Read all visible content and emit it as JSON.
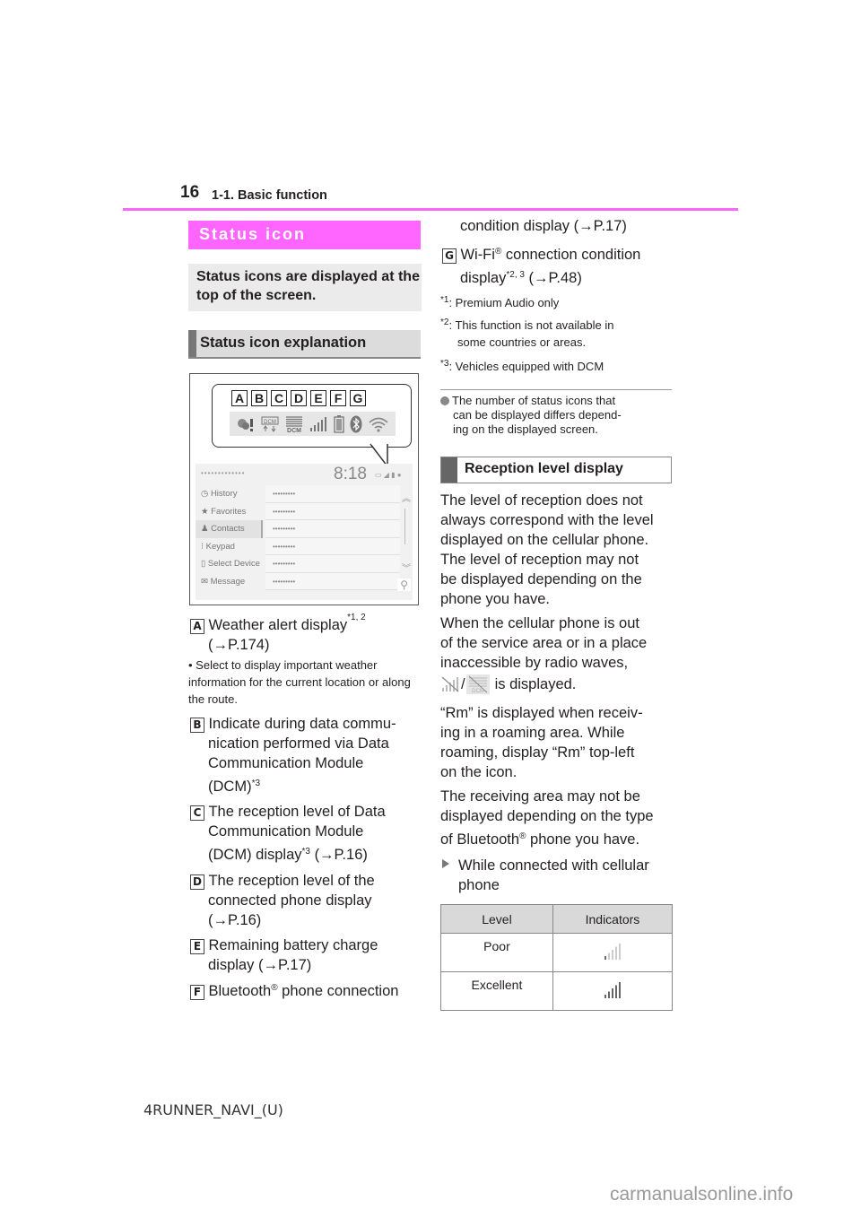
{
  "header": {
    "page_number": "16",
    "section": "1-1. Basic function"
  },
  "left": {
    "section_heading": "Status icon",
    "intro": "Status icons are displayed at the top of the screen.",
    "sub_heading": "Status icon explanation",
    "figure": {
      "letters": [
        "A",
        "B",
        "C",
        "D",
        "E",
        "F",
        "G"
      ],
      "icons": [
        "weather-alert-icon",
        "dcm-data-transfer-icon",
        "dcm-reception-icon",
        "phone-reception-icon",
        "battery-icon",
        "bluetooth-icon",
        "wifi-icon"
      ],
      "dcm_label": "DCM",
      "clock": "8:18",
      "masked_title": "•••••••••••••",
      "menu": [
        "History",
        "Favorites",
        "Contacts",
        "Keypad",
        "Select Device",
        "Message"
      ],
      "active_menu": "Contacts",
      "rows": [
        "•••••••••",
        "•••••••••",
        "•••••••••",
        "•••••••••",
        "•••••••••",
        "•••••••••"
      ]
    },
    "items": [
      {
        "letter": "A",
        "text": "Weather alert display",
        "sup": "*1, 2",
        "ref": "(→P.174)",
        "note": "• Select to display important weather information for the current location or along the route."
      },
      {
        "letter": "B",
        "line1": "Indicate during data commu-",
        "line2": "nication performed via Data",
        "line3": "Communication Module",
        "line4": "(DCM)",
        "sup": "*3"
      },
      {
        "letter": "C",
        "line1": "The reception level of Data",
        "line2": "Communication Module",
        "line3": "(DCM) display",
        "sup": "*3",
        "ref": "(→P.16)"
      },
      {
        "letter": "D",
        "line1": "The reception level of the",
        "line2": "connected phone display",
        "ref": "(→P.16)"
      },
      {
        "letter": "E",
        "line1": "Remaining battery charge",
        "line2": "display (→P.17)"
      },
      {
        "letter": "F",
        "line1a": "Bluetooth",
        "reg": "®",
        "line1b": " phone connection",
        "line2": "condition display (→P.17)"
      }
    ]
  },
  "right": {
    "item_g": {
      "letter": "G",
      "line1a": "Wi-Fi",
      "reg": "®",
      "line1b": " connection condition",
      "line2": "display",
      "sup": "*2, 3",
      "ref": "(→P.48)"
    },
    "footnotes": [
      {
        "mark": "*1",
        "text": ": Premium Audio only"
      },
      {
        "mark": "*2",
        "text": ": This function is not available in",
        "text2": "some countries or areas."
      },
      {
        "mark": "*3",
        "text": ": Vehicles equipped with DCM"
      }
    ],
    "bullet_note": [
      "The number of status icons that",
      "can be displayed differs depend-",
      "ing on the displayed screen."
    ],
    "reception_heading": "Reception level display",
    "para1": [
      "The level of reception does not",
      "always correspond with the level",
      "displayed on the cellular phone.",
      "The level of reception may not",
      "be displayed depending on the",
      "phone you have."
    ],
    "para2": [
      "When the cellular phone is out",
      "of the service area or in a place",
      "inaccessible by radio waves,"
    ],
    "para2_end": "is displayed.",
    "para3": [
      "“Rm” is displayed when receiv-",
      "ing in a roaming area. While",
      "roaming, display “Rm” top-left",
      "on the icon."
    ],
    "para4": [
      "The receiving area may not be",
      "displayed depending on the type"
    ],
    "para4_last_a": "of Bluetooth",
    "para4_reg": "®",
    "para4_last_b": " phone you have.",
    "subitem": [
      "While connected with cellular",
      "phone"
    ],
    "table": {
      "headers": [
        "Level",
        "Indicators"
      ],
      "rows": [
        {
          "level": "Poor",
          "bars_filled": 1,
          "bars_total": 5
        },
        {
          "level": "Excellent",
          "bars_filled": 5,
          "bars_total": 5
        }
      ]
    }
  },
  "footer": {
    "code": "4RUNNER_NAVI_(U)",
    "watermark": "carmanualsonline.info"
  }
}
